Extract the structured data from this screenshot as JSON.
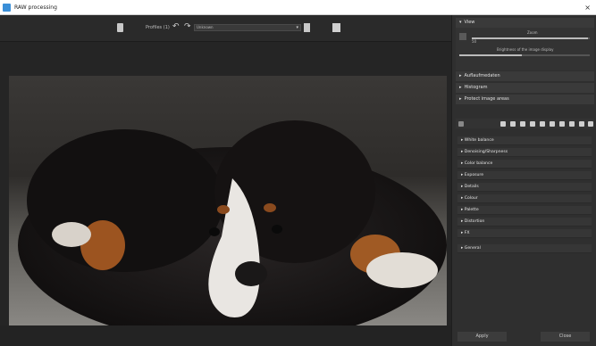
{
  "window": {
    "title": "RAW processing",
    "close_glyph": "×"
  },
  "toolbar": {
    "profiles_label": "Profiles (1)",
    "profile_value": "Unknown",
    "select_arrow": "▾",
    "undo_glyph": "↶",
    "redo_glyph": "↷",
    "doc_icon": "document-icon",
    "save_icon": "save-icon",
    "export_icon": "export-icon"
  },
  "view": {
    "header": "View",
    "zoom_label": "Zoom",
    "brightness_label": "Brightness of the image display",
    "zoom_value": "50"
  },
  "sections": [
    {
      "label": "Auflaufmedaten"
    },
    {
      "label": "Histogram"
    },
    {
      "label": "Protect image areas"
    }
  ],
  "panels": [
    {
      "label": "White balance"
    },
    {
      "label": "Denoising/Sharpness"
    },
    {
      "label": "Color balance"
    },
    {
      "label": "Exposure"
    },
    {
      "label": "Details"
    },
    {
      "label": "Colour"
    },
    {
      "label": "Palette"
    },
    {
      "label": "Distortion"
    },
    {
      "label": "FX"
    },
    {
      "label": "General"
    }
  ],
  "actions": {
    "apply_label": "Apply",
    "close_label": "Close"
  },
  "colors": {
    "bg_dark": "#252525",
    "panel": "#2f2f2f",
    "accent": "#3a8fd8"
  }
}
